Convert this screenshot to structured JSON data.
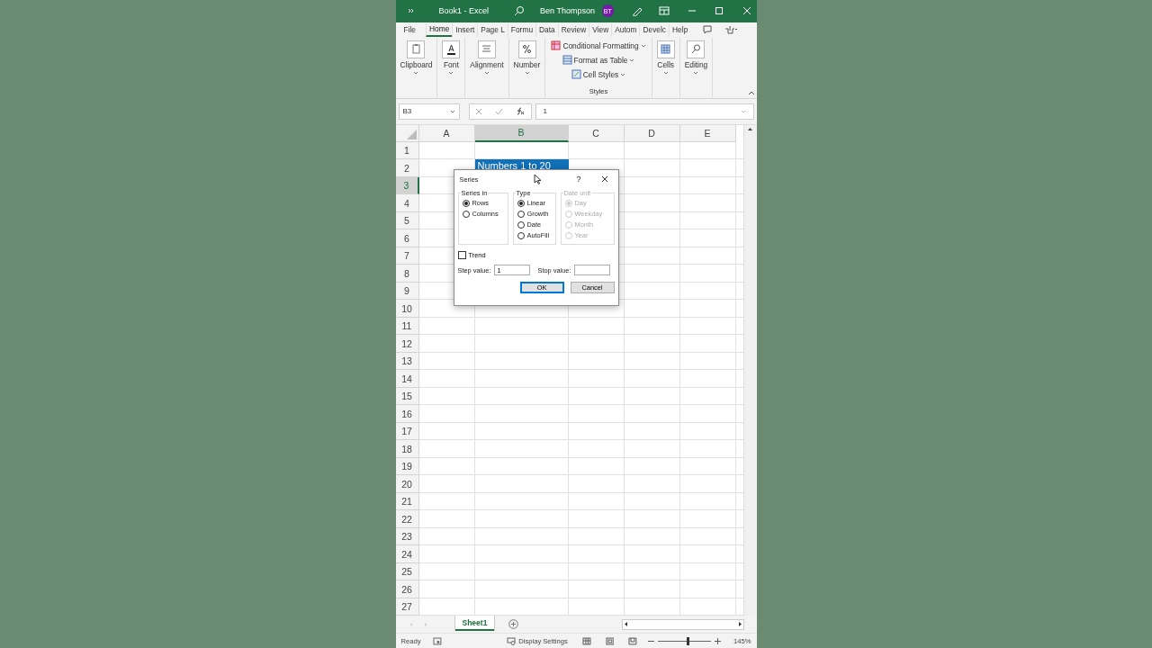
{
  "window": {
    "title": "Book1  -  Excel",
    "user": "Ben Thompson",
    "initials": "BT"
  },
  "ribbon_tabs": [
    {
      "label": "File",
      "selected": false
    },
    {
      "label": "Home",
      "selected": true
    },
    {
      "label": "Insert",
      "selected": false
    },
    {
      "label": "Page L",
      "selected": false
    },
    {
      "label": "Formu",
      "selected": false
    },
    {
      "label": "Data",
      "selected": false
    },
    {
      "label": "Review",
      "selected": false
    },
    {
      "label": "View",
      "selected": false
    },
    {
      "label": "Autom",
      "selected": false
    },
    {
      "label": "Develc",
      "selected": false
    },
    {
      "label": "Help",
      "selected": false
    }
  ],
  "ribbon_groups": [
    {
      "kind": "big",
      "label": "Clipboard"
    },
    {
      "kind": "big",
      "label": "Font"
    },
    {
      "kind": "big",
      "label": "Alignment"
    },
    {
      "kind": "big",
      "label": "Number"
    },
    {
      "kind": "styles",
      "label": "Styles",
      "items": [
        "Conditional Formatting",
        "Format as Table",
        "Cell Styles"
      ]
    },
    {
      "kind": "big",
      "label": "Cells"
    },
    {
      "kind": "big",
      "label": "Editing"
    }
  ],
  "formula_bar": {
    "name_box": "B3",
    "value": "1"
  },
  "columns": [
    {
      "label": "A",
      "selected": false
    },
    {
      "label": "B",
      "selected": true
    },
    {
      "label": "C",
      "selected": false
    },
    {
      "label": "D",
      "selected": false
    },
    {
      "label": "E",
      "selected": false
    }
  ],
  "rows": [
    {
      "label": "1",
      "selected": false
    },
    {
      "label": "2",
      "selected": false
    },
    {
      "label": "3",
      "selected": true
    },
    {
      "label": "4",
      "selected": false
    },
    {
      "label": "5",
      "selected": false
    },
    {
      "label": "6",
      "selected": false
    },
    {
      "label": "7",
      "selected": false
    },
    {
      "label": "8",
      "selected": false
    },
    {
      "label": "9",
      "selected": false
    },
    {
      "label": "10",
      "selected": false
    },
    {
      "label": "11",
      "selected": false
    },
    {
      "label": "12",
      "selected": false
    },
    {
      "label": "13",
      "selected": false
    },
    {
      "label": "14",
      "selected": false
    },
    {
      "label": "15",
      "selected": false
    },
    {
      "label": "16",
      "selected": false
    },
    {
      "label": "17",
      "selected": false
    },
    {
      "label": "18",
      "selected": false
    },
    {
      "label": "19",
      "selected": false
    },
    {
      "label": "20",
      "selected": false
    },
    {
      "label": "21",
      "selected": false
    },
    {
      "label": "22",
      "selected": false
    },
    {
      "label": "23",
      "selected": false
    },
    {
      "label": "24",
      "selected": false
    },
    {
      "label": "25",
      "selected": false
    },
    {
      "label": "26",
      "selected": false
    },
    {
      "label": "27",
      "selected": false
    }
  ],
  "header_cell": {
    "text": "Numbers 1 to 20"
  },
  "dialog": {
    "title": "Series",
    "help": "?",
    "groups": [
      {
        "title": "Series in",
        "disabled": false,
        "options": [
          {
            "label": "Rows",
            "selected": true
          },
          {
            "label": "Columns",
            "selected": false
          }
        ]
      },
      {
        "title": "Type",
        "disabled": false,
        "options": [
          {
            "label": "Linear",
            "selected": true
          },
          {
            "label": "Growth",
            "selected": false
          },
          {
            "label": "Date",
            "selected": false
          },
          {
            "label": "AutoFill",
            "selected": false
          }
        ]
      },
      {
        "title": "Date unit",
        "disabled": true,
        "options": [
          {
            "label": "Day",
            "selected": true
          },
          {
            "label": "Weekday",
            "selected": false
          },
          {
            "label": "Month",
            "selected": false
          },
          {
            "label": "Year",
            "selected": false
          }
        ]
      }
    ],
    "trend": {
      "label": "Trend",
      "checked": false
    },
    "step": {
      "label": "Step value:",
      "value": "1"
    },
    "stop": {
      "label": "Stop value:"
    },
    "buttons": [
      {
        "label": "OK",
        "default": true
      },
      {
        "label": "Cancel",
        "default": false
      }
    ]
  },
  "sheets": [
    {
      "label": "Sheet1",
      "selected": true
    }
  ],
  "status": {
    "ready": "Ready",
    "display": "Display Settings",
    "zoom": "145%",
    "level": 0.55
  }
}
